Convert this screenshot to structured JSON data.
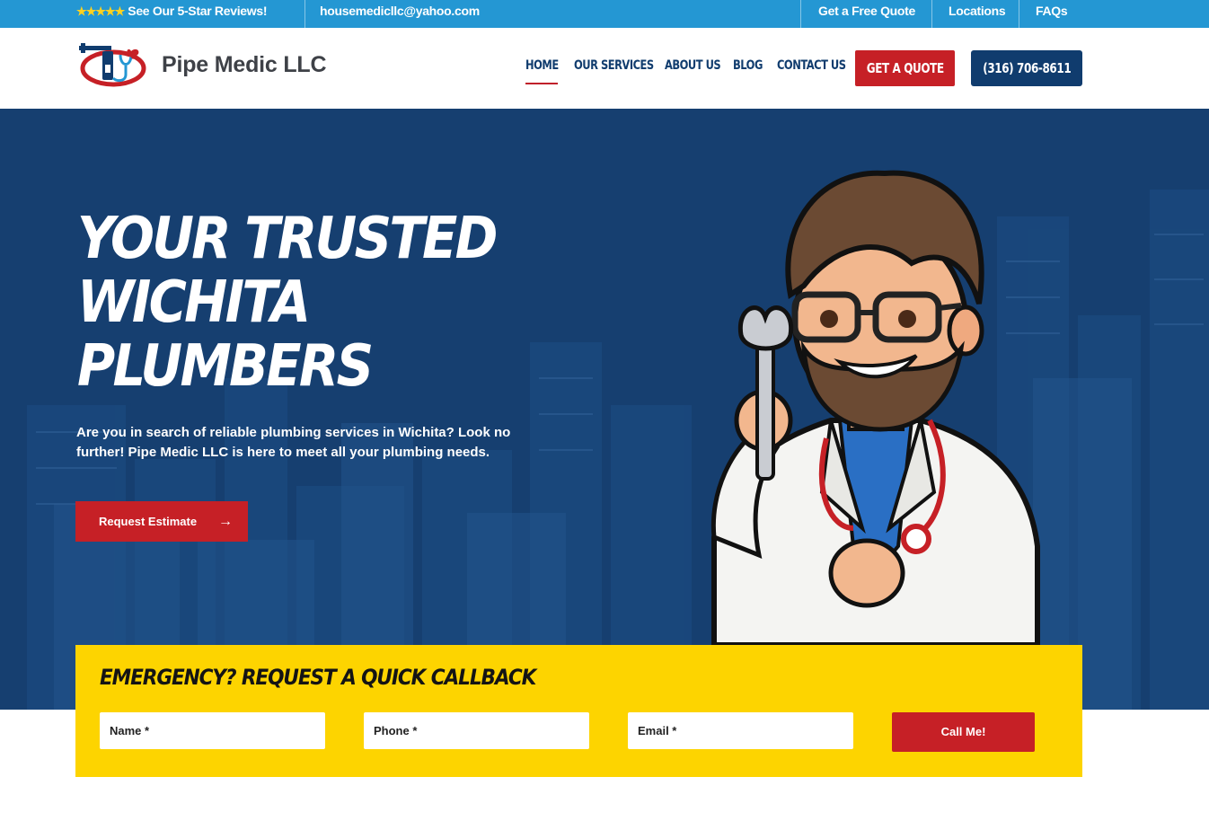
{
  "topbar": {
    "stars": "★★★★★",
    "reviews_label": "See Our 5-Star Reviews!",
    "email": "housemedicllc@yahoo.com",
    "links": [
      "Get a Free Quote",
      "Locations",
      "FAQs"
    ]
  },
  "header": {
    "brand": "Pipe Medic LLC",
    "nav": [
      "HOME",
      "OUR SERVICES",
      "ABOUT US",
      "BLOG",
      "CONTACT US"
    ],
    "active_nav": "HOME",
    "quote_button": "GET A QUOTE",
    "phone_button": "(316) 706-8611"
  },
  "hero": {
    "title_lines": [
      "YOUR TRUSTED",
      "WICHITA",
      "PLUMBERS"
    ],
    "description": "Are you in search of reliable plumbing services in Wichita? Look no further! Pipe Medic LLC is here to meet all your plumbing needs.",
    "cta_label": "Request Estimate",
    "cta_icon": "arrow-right-icon"
  },
  "callback": {
    "title": "EMERGENCY? REQUEST A QUICK CALLBACK",
    "name_placeholder": "Name *",
    "phone_placeholder": "Phone *",
    "email_placeholder": "Email *",
    "submit_label": "Call Me!"
  },
  "colors": {
    "topbar_blue": "#2497d3",
    "navy": "#103c6e",
    "brand_red": "#c62026",
    "callback_yellow": "#fdd400"
  }
}
